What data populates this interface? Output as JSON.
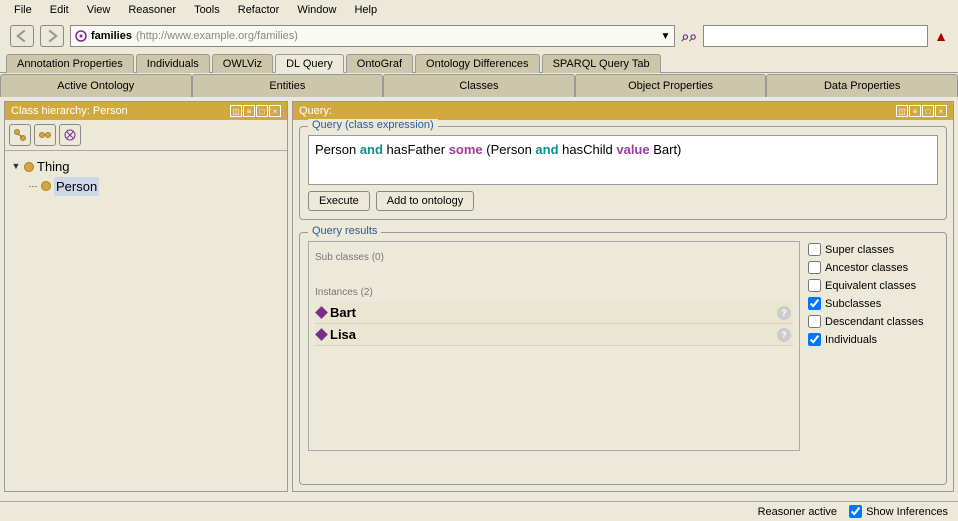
{
  "menu": [
    "File",
    "Edit",
    "View",
    "Reasoner",
    "Tools",
    "Refactor",
    "Window",
    "Help"
  ],
  "ontology": {
    "name": "families",
    "uri": "(http://www.example.org/families)"
  },
  "tabs_lower": [
    "Annotation Properties",
    "Individuals",
    "OWLViz",
    "DL Query",
    "OntoGraf",
    "Ontology Differences",
    "SPARQL Query Tab"
  ],
  "tabs_lower_active": "DL Query",
  "tabs_upper": [
    "Active Ontology",
    "Entities",
    "Classes",
    "Object Properties",
    "Data Properties"
  ],
  "left_panel": {
    "title": "Class hierarchy: Person",
    "tree": {
      "root": "Thing",
      "children": [
        "Person"
      ],
      "selected": "Person"
    }
  },
  "right_panel": {
    "title": "Query:",
    "query_section_label": "Query (class expression)",
    "query_tokens": [
      {
        "t": "Person",
        "c": "plain"
      },
      {
        "t": " and ",
        "c": "and"
      },
      {
        "t": "hasFather",
        "c": "plain"
      },
      {
        "t": " some ",
        "c": "some"
      },
      {
        "t": "(Person",
        "c": "plain"
      },
      {
        "t": " and ",
        "c": "and"
      },
      {
        "t": "hasChild",
        "c": "plain"
      },
      {
        "t": " value ",
        "c": "value"
      },
      {
        "t": "Bart)",
        "c": "plain"
      }
    ],
    "buttons": {
      "execute": "Execute",
      "add": "Add to ontology"
    },
    "results_label": "Query results",
    "subclasses_label": "Sub classes (0)",
    "instances_label": "Instances (2)",
    "instances": [
      "Bart",
      "Lisa"
    ],
    "options": [
      {
        "label": "Super classes",
        "checked": false
      },
      {
        "label": "Ancestor classes",
        "checked": false
      },
      {
        "label": "Equivalent classes",
        "checked": false
      },
      {
        "label": "Subclasses",
        "checked": true
      },
      {
        "label": "Descendant classes",
        "checked": false
      },
      {
        "label": "Individuals",
        "checked": true
      }
    ]
  },
  "status": {
    "reasoner": "Reasoner active",
    "inferences_label": "Show Inferences",
    "inferences_checked": true
  }
}
